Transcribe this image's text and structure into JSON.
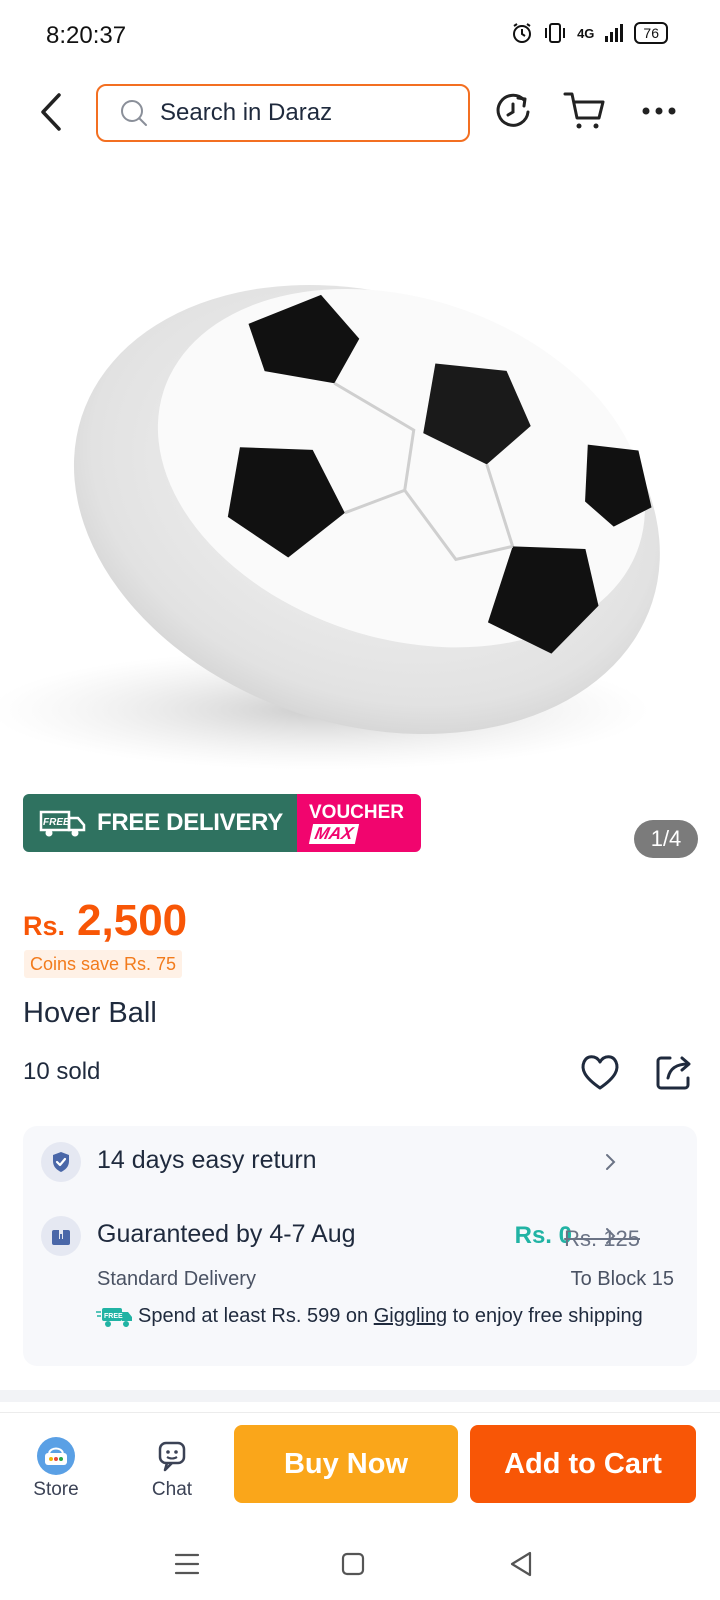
{
  "status_bar": {
    "time": "8:20:37",
    "network": "4G",
    "battery": "76"
  },
  "header": {
    "search_placeholder": "Search in Daraz"
  },
  "product": {
    "image_pager": "1/4",
    "badges": {
      "free_delivery_tag": "FREE",
      "free_delivery": "FREE DELIVERY",
      "voucher_line1": "VOUCHER",
      "voucher_line2": "MAX"
    },
    "price_currency": "Rs.",
    "price_amount": "2,500",
    "coins_save": "Coins save Rs. 75",
    "title": "Hover Ball",
    "sold": "10 sold"
  },
  "delivery": {
    "returns": "14 days easy return",
    "guarantee": "Guaranteed by 4-7 Aug",
    "shipping_fee": "Rs. 0",
    "shipping_original": "Rs. 125",
    "delivery_type": "Standard Delivery",
    "destination": "To Block 15",
    "promo_prefix": "Spend at least Rs. 599 on ",
    "promo_store": "Giggling",
    "promo_suffix": " to enjoy free shipping",
    "promo_icon_tag": "FREE"
  },
  "bottom_bar": {
    "store_label": "Store",
    "chat_label": "Chat",
    "buy_now": "Buy Now",
    "add_to_cart": "Add to Cart"
  },
  "colors": {
    "brand_orange": "#f85606",
    "buy_now": "#faa61a",
    "free_delivery": "#2f7260",
    "voucher": "#f1056e",
    "free_shipping_teal": "#21b3a4"
  }
}
